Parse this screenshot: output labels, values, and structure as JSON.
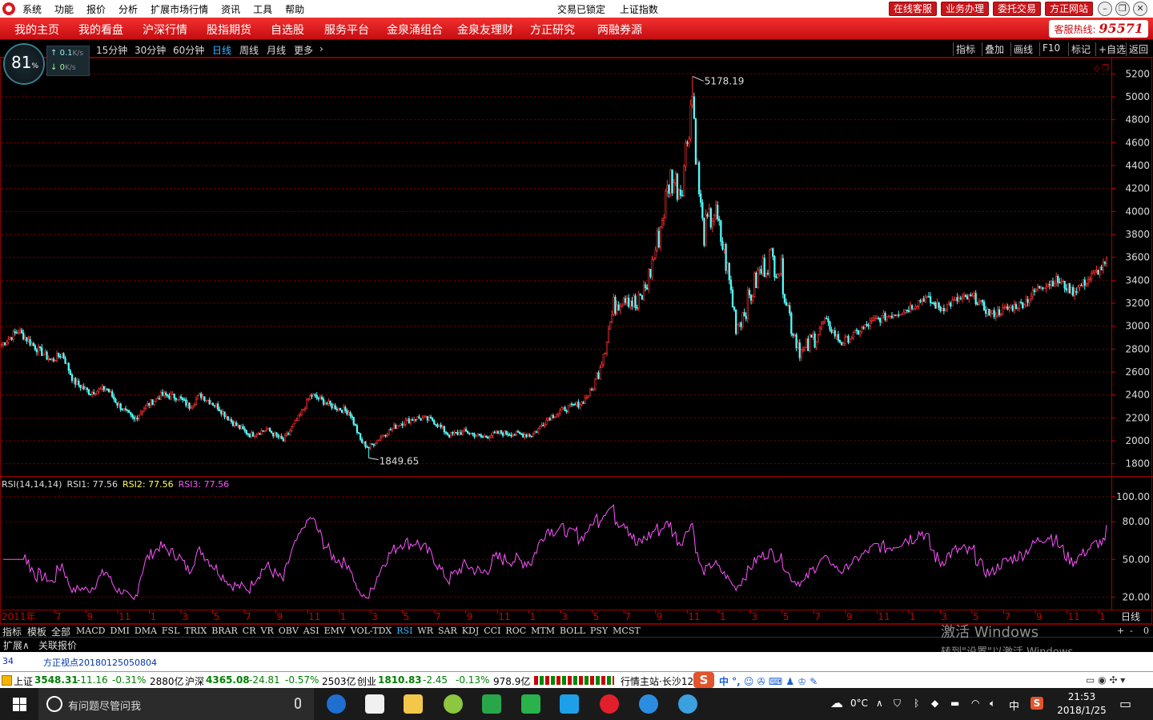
{
  "titlebar": {
    "menu": [
      "系统",
      "功能",
      "报价",
      "分析",
      "扩展市场行情",
      "资讯",
      "工具",
      "帮助"
    ],
    "status": "交易已锁定",
    "title": "上证指数",
    "buttons": [
      "在线客服",
      "业务办理",
      "委托交易",
      "方正网站"
    ]
  },
  "nav": {
    "items": [
      "我的主页",
      "我的看盘",
      "沪深行情",
      "股指期货",
      "自选股",
      "服务平台",
      "金泉涌组合",
      "金泉友理财",
      "方正研究",
      "两融券源"
    ],
    "hotline_label": "客服热线:",
    "hotline_number": "95571"
  },
  "toolbar": {
    "periods": [
      "15分钟",
      "30分钟",
      "60分钟",
      "日线",
      "周线",
      "月线",
      "更多"
    ],
    "active_period": "日线",
    "right_tools": [
      "指标",
      "叠加",
      "画线",
      "F10",
      "标记",
      "+自选",
      "返回"
    ]
  },
  "gauge": {
    "percent": "81",
    "percent_unit": "%",
    "up_speed": "0.1",
    "down_speed": "0",
    "unit": "K/s"
  },
  "chart_data": {
    "type": "candlestick",
    "title": "上证指数",
    "period": "日线",
    "price_axis": {
      "ticks": [
        1800,
        2000,
        2200,
        2400,
        2600,
        2800,
        3000,
        3200,
        3400,
        3600,
        3800,
        4000,
        4200,
        4400,
        4600,
        4800,
        5000,
        5200
      ],
      "ylim": [
        1700,
        5300
      ]
    },
    "annotations": {
      "high": "5178.19",
      "low": "1849.65"
    },
    "x_axis": {
      "year_label": "2011年",
      "month_ticks": [
        "7",
        "9",
        "11",
        "1",
        "3",
        "5",
        "7",
        "9",
        "11",
        "1",
        "3",
        "5",
        "7",
        "9",
        "11",
        "1",
        "3",
        "5",
        "7",
        "9",
        "11",
        "1",
        "3",
        "5",
        "7",
        "9",
        "11",
        "1",
        "3",
        "5",
        "7",
        "9",
        "11",
        "1"
      ]
    },
    "series_close": [
      {
        "t": 0,
        "v": 2840
      },
      {
        "t": 0.015,
        "v": 2960
      },
      {
        "t": 0.03,
        "v": 2820
      },
      {
        "t": 0.045,
        "v": 2700
      },
      {
        "t": 0.055,
        "v": 2760
      },
      {
        "t": 0.065,
        "v": 2520
      },
      {
        "t": 0.08,
        "v": 2420
      },
      {
        "t": 0.095,
        "v": 2460
      },
      {
        "t": 0.105,
        "v": 2320
      },
      {
        "t": 0.12,
        "v": 2180
      },
      {
        "t": 0.13,
        "v": 2300
      },
      {
        "t": 0.145,
        "v": 2400
      },
      {
        "t": 0.16,
        "v": 2380
      },
      {
        "t": 0.17,
        "v": 2300
      },
      {
        "t": 0.18,
        "v": 2400
      },
      {
        "t": 0.195,
        "v": 2300
      },
      {
        "t": 0.21,
        "v": 2150
      },
      {
        "t": 0.225,
        "v": 2050
      },
      {
        "t": 0.24,
        "v": 2100
      },
      {
        "t": 0.255,
        "v": 2000
      },
      {
        "t": 0.27,
        "v": 2220
      },
      {
        "t": 0.28,
        "v": 2400
      },
      {
        "t": 0.29,
        "v": 2350
      },
      {
        "t": 0.3,
        "v": 2300
      },
      {
        "t": 0.315,
        "v": 2250
      },
      {
        "t": 0.325,
        "v": 2000
      },
      {
        "t": 0.332,
        "v": 1940
      },
      {
        "t": 0.345,
        "v": 2050
      },
      {
        "t": 0.36,
        "v": 2150
      },
      {
        "t": 0.375,
        "v": 2200
      },
      {
        "t": 0.39,
        "v": 2180
      },
      {
        "t": 0.405,
        "v": 2050
      },
      {
        "t": 0.42,
        "v": 2080
      },
      {
        "t": 0.435,
        "v": 2030
      },
      {
        "t": 0.45,
        "v": 2070
      },
      {
        "t": 0.465,
        "v": 2060
      },
      {
        "t": 0.48,
        "v": 2050
      },
      {
        "t": 0.495,
        "v": 2200
      },
      {
        "t": 0.51,
        "v": 2280
      },
      {
        "t": 0.525,
        "v": 2330
      },
      {
        "t": 0.535,
        "v": 2450
      },
      {
        "t": 0.545,
        "v": 2800
      },
      {
        "t": 0.555,
        "v": 3200
      },
      {
        "t": 0.565,
        "v": 3300
      },
      {
        "t": 0.575,
        "v": 3150
      },
      {
        "t": 0.585,
        "v": 3400
      },
      {
        "t": 0.595,
        "v": 3800
      },
      {
        "t": 0.605,
        "v": 4300
      },
      {
        "t": 0.615,
        "v": 4200
      },
      {
        "t": 0.62,
        "v": 4600
      },
      {
        "t": 0.625,
        "v": 5050
      },
      {
        "t": 0.63,
        "v": 4300
      },
      {
        "t": 0.635,
        "v": 3800
      },
      {
        "t": 0.645,
        "v": 4000
      },
      {
        "t": 0.655,
        "v": 3600
      },
      {
        "t": 0.665,
        "v": 3000
      },
      {
        "t": 0.675,
        "v": 3200
      },
      {
        "t": 0.685,
        "v": 3450
      },
      {
        "t": 0.695,
        "v": 3600
      },
      {
        "t": 0.705,
        "v": 3500
      },
      {
        "t": 0.715,
        "v": 3000
      },
      {
        "t": 0.725,
        "v": 2750
      },
      {
        "t": 0.735,
        "v": 2900
      },
      {
        "t": 0.745,
        "v": 3050
      },
      {
        "t": 0.76,
        "v": 2850
      },
      {
        "t": 0.775,
        "v": 2950
      },
      {
        "t": 0.79,
        "v": 3050
      },
      {
        "t": 0.805,
        "v": 3100
      },
      {
        "t": 0.82,
        "v": 3150
      },
      {
        "t": 0.835,
        "v": 3250
      },
      {
        "t": 0.85,
        "v": 3150
      },
      {
        "t": 0.865,
        "v": 3230
      },
      {
        "t": 0.88,
        "v": 3250
      },
      {
        "t": 0.895,
        "v": 3100
      },
      {
        "t": 0.91,
        "v": 3150
      },
      {
        "t": 0.925,
        "v": 3200
      },
      {
        "t": 0.94,
        "v": 3350
      },
      {
        "t": 0.955,
        "v": 3400
      },
      {
        "t": 0.97,
        "v": 3300
      },
      {
        "t": 0.985,
        "v": 3420
      },
      {
        "t": 1.0,
        "v": 3548
      }
    ],
    "rsi": {
      "label": "RSI(14,14,14)",
      "rsi1_label": "RSI1:",
      "rsi1": "77.56",
      "rsi2_label": "RSI2:",
      "rsi2": "77.56",
      "rsi3_label": "RSI3:",
      "rsi3": "77.56",
      "ticks": [
        "100.00",
        "80.00",
        "50.00",
        "20.00"
      ]
    }
  },
  "indicator_tabs": {
    "first": [
      "指标",
      "模板",
      "全部"
    ],
    "list": [
      "MACD",
      "DMI",
      "DMA",
      "FSL",
      "TRIX",
      "BRAR",
      "CR",
      "VR",
      "OBV",
      "ASI",
      "EMV",
      "VOL-TDX",
      "RSI",
      "WR",
      "SAR",
      "KDJ",
      "CCI",
      "ROC",
      "MTM",
      "BOLL",
      "PSY",
      "MCST"
    ],
    "active": "RSI",
    "right": [
      "+",
      "-",
      "0"
    ]
  },
  "ext_tabs": [
    "扩展∧",
    "关联报价"
  ],
  "period_label": "日线",
  "news": {
    "number": "34",
    "title": "方正视点20180125050804"
  },
  "quote_bar": {
    "sh_label": "上证",
    "sh_value": "3548.31",
    "sh_change": "-11.16",
    "sh_pct": "-0.31%",
    "sh_amount": "2880亿",
    "hs_label": "沪深",
    "hs_value": "4365.08",
    "hs_change": "-24.81",
    "hs_pct": "-0.57%",
    "hs_amount": "2503亿",
    "cy_label": "创业",
    "cy_value": "1810.83",
    "cy_change": "-2.45",
    "cy_pct": "-0.13%",
    "cy_amount": "978.9亿",
    "server": "行情主站·长沙12"
  },
  "taskbar": {
    "search_placeholder": "有问题尽管问我",
    "temperature": "0°C",
    "ime": "中",
    "time": "21:53",
    "date": "2018/1/25"
  },
  "watermark": {
    "line1": "激活 Windows",
    "line2": "转到\"设置\"以激活 Windows。"
  }
}
